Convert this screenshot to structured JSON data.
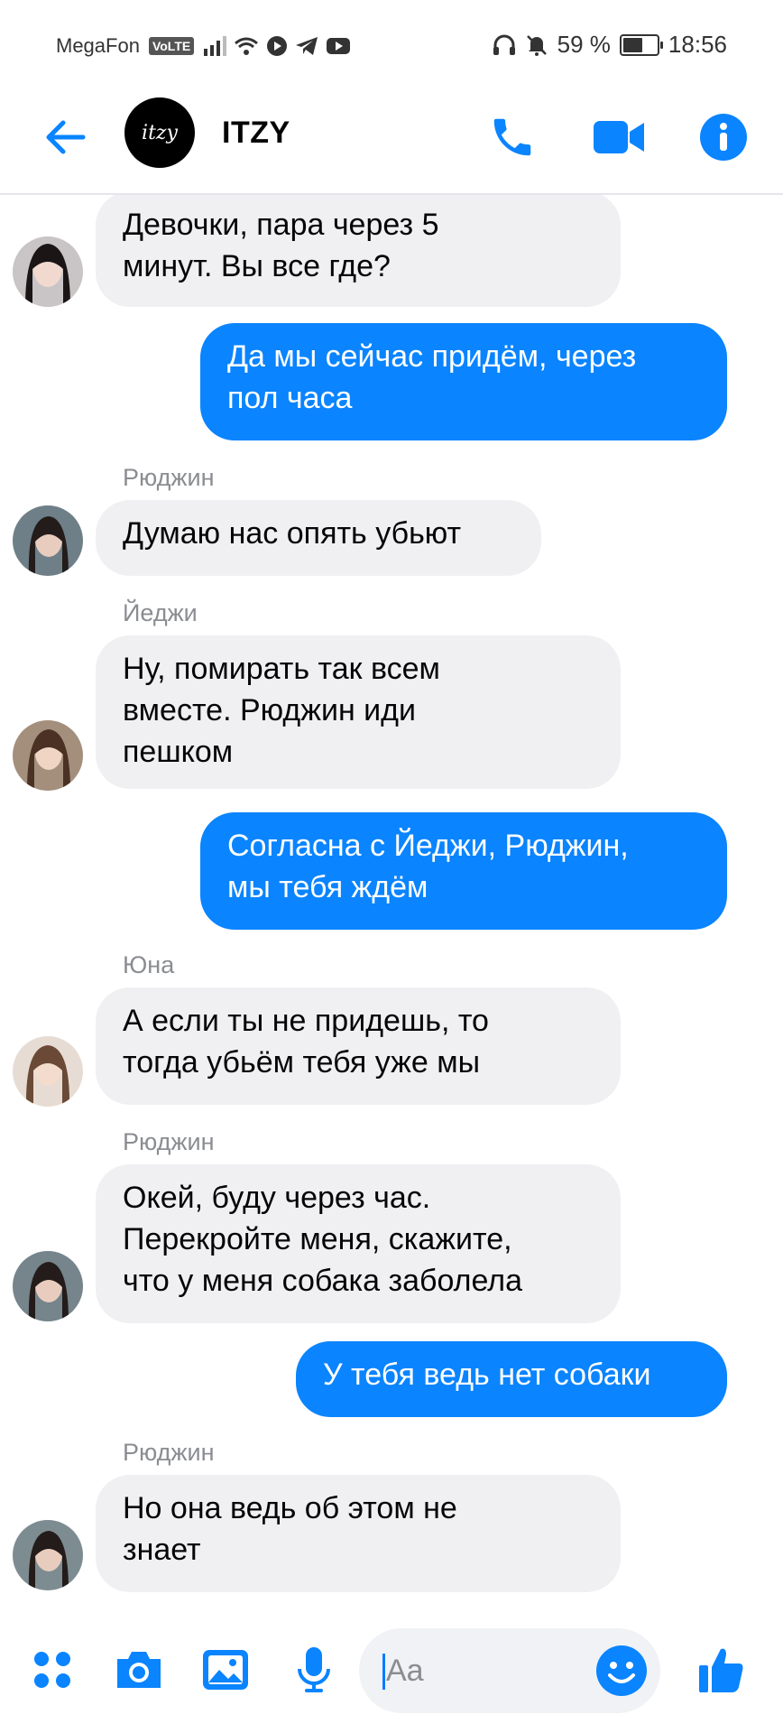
{
  "status_bar": {
    "carrier": "MegaFon",
    "volte": "VoLTE",
    "battery_percent": "59 %",
    "battery_level": 0.59,
    "time": "18:56"
  },
  "header": {
    "group_avatar_text": "itzy",
    "group_name": "ITZY",
    "icons": [
      "back-arrow-icon",
      "phone-icon",
      "video-icon",
      "info-icon"
    ]
  },
  "colors": {
    "accent": "#0a84ff",
    "incoming_bubble": "#f0f0f3",
    "sender_label": "#8a8d91"
  },
  "messages": [
    {
      "direction": "in",
      "sender": "",
      "text": "Девочки, пара через 5\nминут. Вы все где?"
    },
    {
      "direction": "out",
      "text": "Да мы сейчас придём, через\nпол часа"
    },
    {
      "direction": "in",
      "sender": "Рюджин",
      "text": "Думаю нас опять убьют"
    },
    {
      "direction": "in",
      "sender": "Йеджи",
      "text": "Ну, помирать так всем\nвместе. Рюджин иди\nпешком"
    },
    {
      "direction": "out",
      "text": "Согласна с Йеджи, Рюджин,\nмы тебя ждём"
    },
    {
      "direction": "in",
      "sender": "Юна",
      "text": "А если ты не придешь, то\nтогда убьём тебя уже мы"
    },
    {
      "direction": "in",
      "sender": "Рюджин",
      "text": "Окей, буду через час.\nПерекройте меня, скажите,\nчто у меня собака заболела"
    },
    {
      "direction": "out",
      "text": "У тебя ведь нет собаки"
    },
    {
      "direction": "in",
      "sender": "Рюджин",
      "text": "Но она ведь об этом не\nзнает"
    }
  ],
  "composer": {
    "placeholder": "Aa",
    "icons": [
      "apps-icon",
      "camera-icon",
      "gallery-icon",
      "microphone-icon",
      "emoji-icon",
      "thumbs-up-icon"
    ]
  }
}
